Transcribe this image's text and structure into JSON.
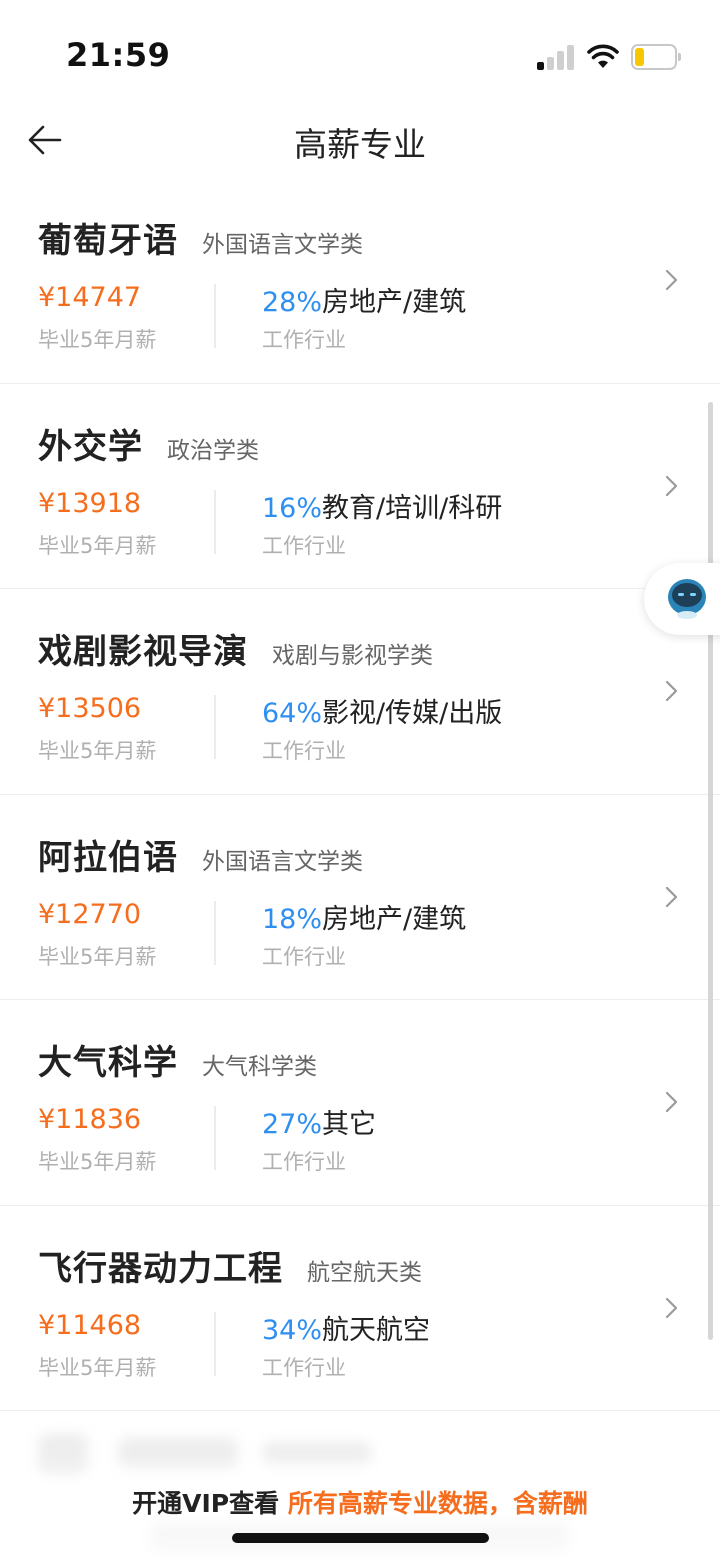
{
  "status_bar": {
    "time": "21:59"
  },
  "nav": {
    "title": "高薪专业"
  },
  "majors": [
    {
      "name": "葡萄牙语",
      "category": "外国语言文学类",
      "salary": "¥14747",
      "salary_label": "毕业5年月薪",
      "industry_pct": "28%",
      "industry": "房地产/建筑",
      "industry_label": "工作行业"
    },
    {
      "name": "外交学",
      "category": "政治学类",
      "salary": "¥13918",
      "salary_label": "毕业5年月薪",
      "industry_pct": "16%",
      "industry": "教育/培训/科研",
      "industry_label": "工作行业"
    },
    {
      "name": "戏剧影视导演",
      "category": "戏剧与影视学类",
      "salary": "¥13506",
      "salary_label": "毕业5年月薪",
      "industry_pct": "64%",
      "industry": "影视/传媒/出版",
      "industry_label": "工作行业"
    },
    {
      "name": "阿拉伯语",
      "category": "外国语言文学类",
      "salary": "¥12770",
      "salary_label": "毕业5年月薪",
      "industry_pct": "18%",
      "industry": "房地产/建筑",
      "industry_label": "工作行业"
    },
    {
      "name": "大气科学",
      "category": "大气科学类",
      "salary": "¥11836",
      "salary_label": "毕业5年月薪",
      "industry_pct": "27%",
      "industry": "其它",
      "industry_label": "工作行业"
    },
    {
      "name": "飞行器动力工程",
      "category": "航空航天类",
      "salary": "¥11468",
      "salary_label": "毕业5年月薪",
      "industry_pct": "34%",
      "industry": "航天航空",
      "industry_label": "工作行业"
    }
  ],
  "vip_banner": {
    "prefix": "开通VIP查看 ",
    "highlight": "所有高薪专业数据，含薪酬"
  },
  "colors": {
    "salary": "#f56d1d",
    "percent": "#2f8ff0",
    "battery": "#f7c600"
  }
}
